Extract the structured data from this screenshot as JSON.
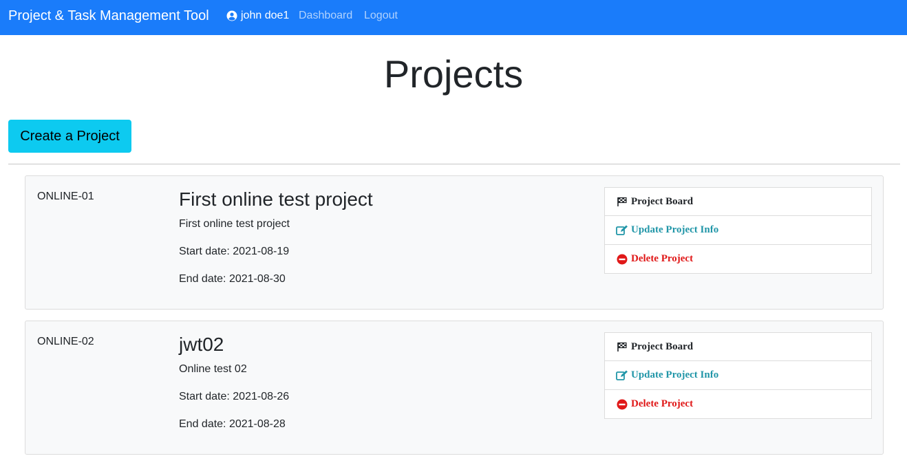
{
  "nav": {
    "brand": "Project & Task Management Tool",
    "user": "john doe1",
    "dashboard": "Dashboard",
    "logout": "Logout",
    "colors": {
      "bar": "#1a7cfa"
    }
  },
  "page": {
    "title": "Projects",
    "create_label": "Create a Project"
  },
  "projects": [
    {
      "id": "ONLINE-01",
      "name": "First online test project",
      "description": "First online test project",
      "start": "Start date: 2021-08-19",
      "end": "End date: 2021-08-30",
      "actions": {
        "board": "Project Board",
        "update": "Update Project Info",
        "delete": "Delete Project"
      }
    },
    {
      "id": "ONLINE-02",
      "name": "jwt02",
      "description": "Online test 02",
      "start": "Start date: 2021-08-26",
      "end": "End date: 2021-08-28",
      "actions": {
        "board": "Project Board",
        "update": "Update Project Info",
        "delete": "Delete Project"
      }
    }
  ],
  "icons": {
    "user": "user-circle-icon",
    "board": "flag-checkered-icon",
    "update": "edit-icon",
    "delete": "minus-circle-icon"
  }
}
